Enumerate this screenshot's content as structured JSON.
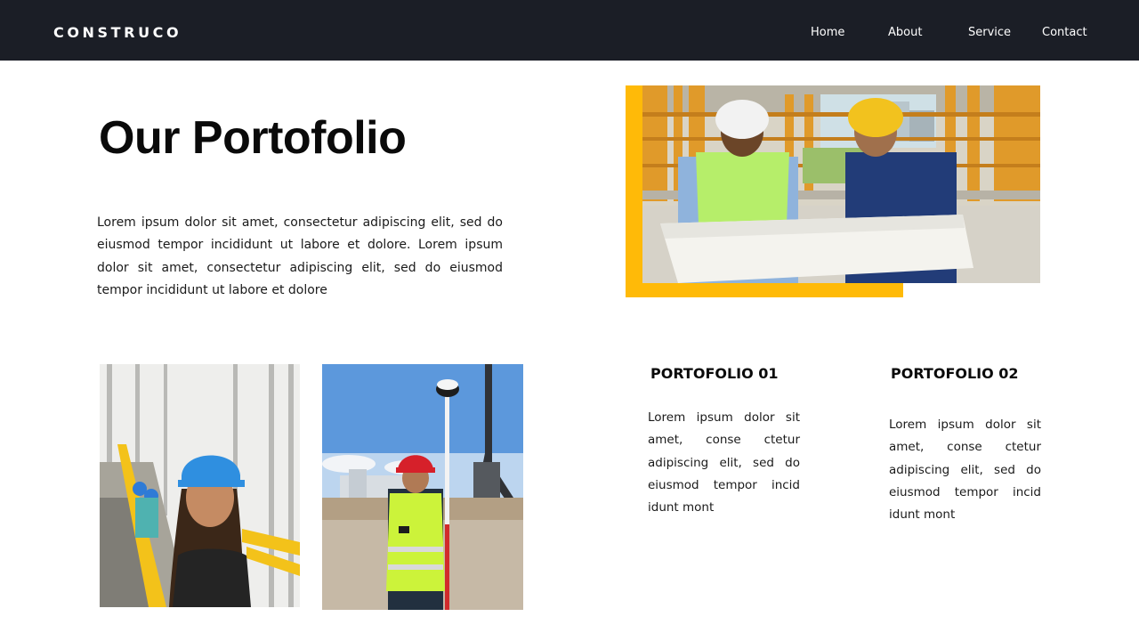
{
  "header": {
    "brand": "CONSTRUCO",
    "nav": [
      "Home",
      "About",
      "Service",
      "Contact"
    ]
  },
  "main": {
    "title": "Our Portofolio",
    "intro": "Lorem ipsum dolor sit amet, consectetur adipiscing elit, sed do eiusmod tempor incididunt ut labore et dolore. Lorem ipsum dolor sit amet, consectetur adipiscing elit, sed do eiusmod tempor incididunt ut labore et dolore"
  },
  "portfolio": [
    {
      "title": "PORTOFOLIO 01",
      "text": "Lorem ipsum dolor sit amet, conse ctetur adipiscing elit, sed do eiusmod tempor incid idunt mont"
    },
    {
      "title": "PORTOFOLIO 02",
      "text": "Lorem ipsum dolor sit amet, conse ctetur adipiscing elit, sed do eiusmod tempor incid idunt mont"
    }
  ],
  "colors": {
    "navbar": "#1b1e26",
    "accent": "#ffba08",
    "text": "#111111"
  },
  "images": {
    "hero": "two-construction-workers-reading-blueprint-photo",
    "worker_woman": "woman-with-blue-hardhat-on-bridge-photo",
    "surveyor": "surveyor-with-red-hardhat-and-gps-pole-photo"
  }
}
